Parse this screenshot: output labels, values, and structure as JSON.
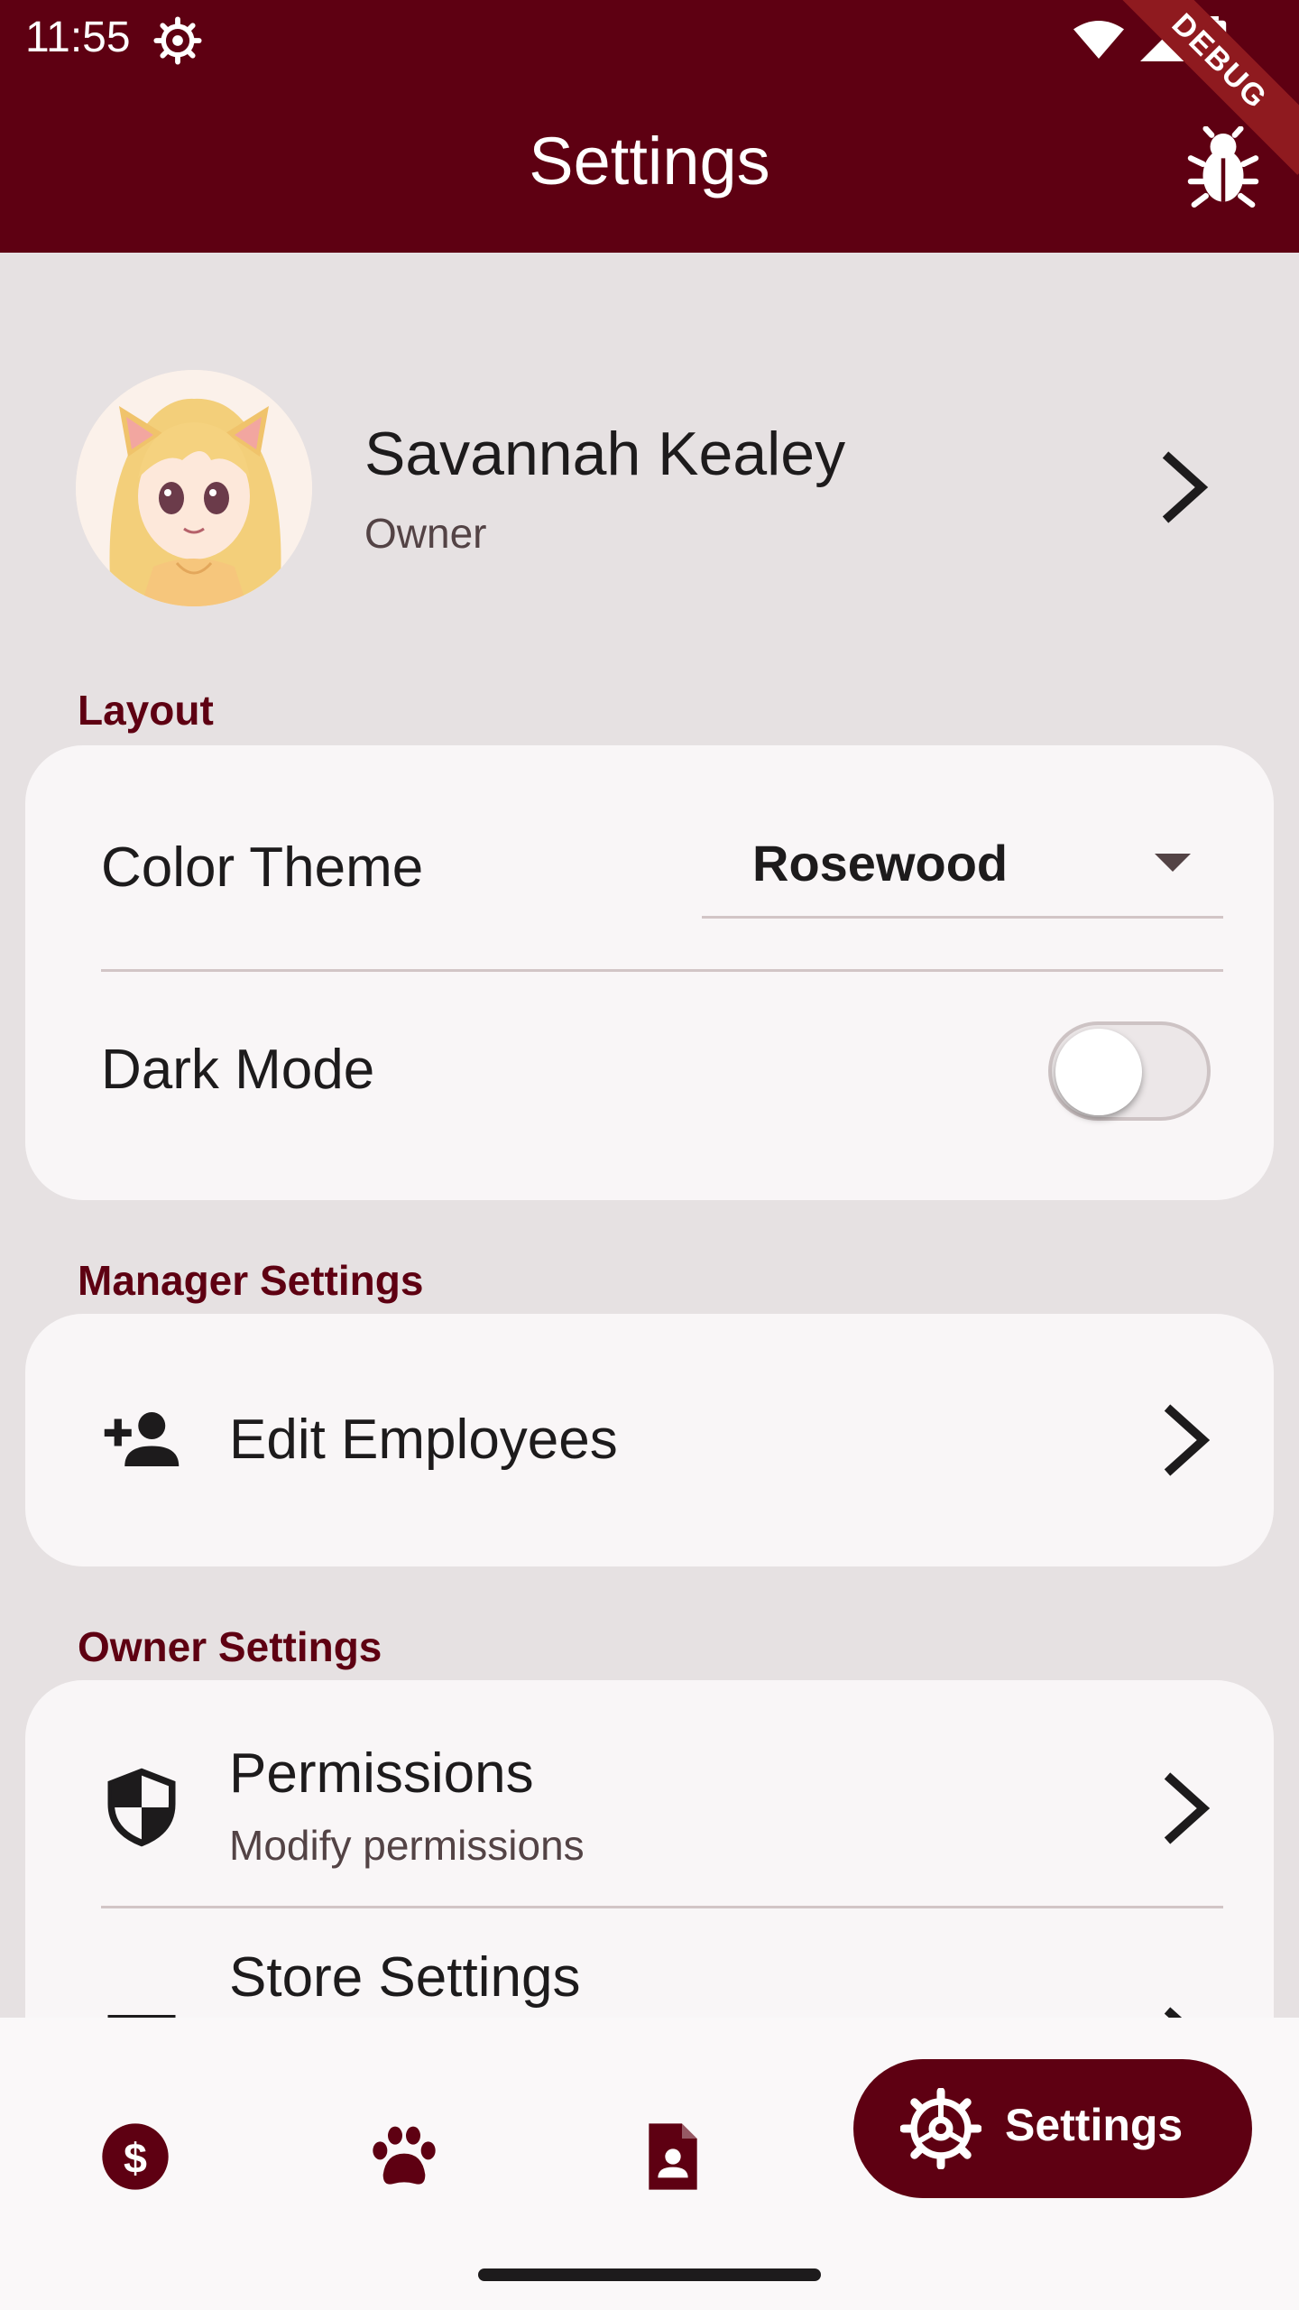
{
  "theme": {
    "brand": "#5e0012",
    "surface": "#f9f6f7",
    "background": "#e6e1e2"
  },
  "status_bar": {
    "time": "11:55",
    "debug_banner": "DEBUG"
  },
  "appbar": {
    "title": "Settings"
  },
  "profile": {
    "name": "Savannah Kealey",
    "role": "Owner"
  },
  "layout_section": {
    "label": "Layout",
    "color_theme": {
      "label": "Color Theme",
      "value": "Rosewood"
    },
    "dark_mode": {
      "label": "Dark Mode",
      "enabled": false
    }
  },
  "manager_section": {
    "label": "Manager Settings",
    "edit_employees": {
      "label": "Edit Employees",
      "icon": "person-add-icon"
    }
  },
  "owner_section": {
    "label": "Owner Settings",
    "permissions": {
      "label": "Permissions",
      "sub": "Modify permissions",
      "icon": "shield-icon"
    },
    "store_settings": {
      "label": "Store Settings",
      "icon": "store-icon"
    }
  },
  "bottom_nav": {
    "items": [
      {
        "icon": "dollar-icon"
      },
      {
        "icon": "paw-icon"
      },
      {
        "icon": "document-person-icon"
      }
    ],
    "active": {
      "label": "Settings",
      "icon": "settings-gear-icon"
    }
  }
}
